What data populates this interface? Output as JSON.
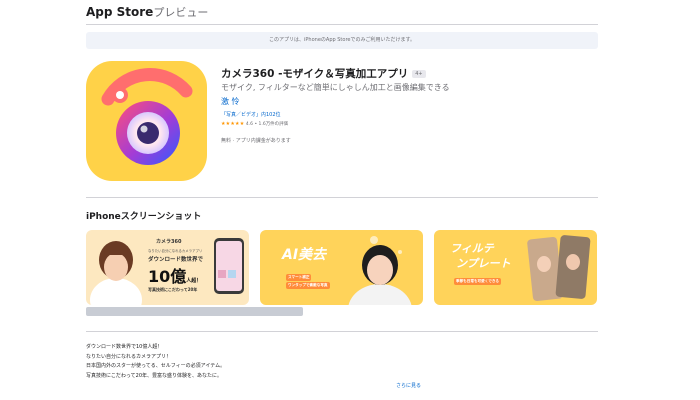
{
  "header": {
    "brand": "App Store",
    "brand_suffix": "プレビュー"
  },
  "notice": "このアプリは、iPhoneのApp Storeでのみご利用いただけます。",
  "app": {
    "title": "カメラ360 -モザイク＆写真加工アプリ",
    "age_rating": "4+",
    "subtitle": "モザイク, フィルターなど簡単にしゃしん加工と画像編集できる",
    "developer": "激 怜",
    "ranking": "「写真／ビデオ」内102位",
    "stars": "★★★★★",
    "rating_text": "4.6 • 1.6万件の評価",
    "price": "無料 · アプリ内課金があります"
  },
  "screenshots": {
    "title": "iPhoneスクリーンショット",
    "items": [
      {
        "logo": "カメラ360",
        "line1": "なりたい自分になれるカメラアプリ",
        "line2": "ダウンロード数世界で",
        "big": "10億",
        "big_suffix": "人超！",
        "line3": "写真技術にこだわって20年"
      },
      {
        "big": "AI美去",
        "line1": "スマート補正",
        "line2": "ワンタップで素敵な写真"
      },
      {
        "big": "フィルテ",
        "big2": "ンプレート",
        "line1": "季節も日常も可愛くできる"
      }
    ]
  },
  "description": {
    "lines": [
      "ダウンロード数世界で10億人超！",
      "なりたい自分になれるカメラアプリ！",
      "日本国内外のスターが使ってる、セルフィーの必須アイテム。",
      "写真技術にこだわって20年、豊富な盛り体験を、あなたに。"
    ],
    "more": "さらに見る"
  },
  "colors": {
    "accent": "#0066cc",
    "icon_bg": "#ffd248",
    "banner_yellow": "#ffd35a"
  }
}
